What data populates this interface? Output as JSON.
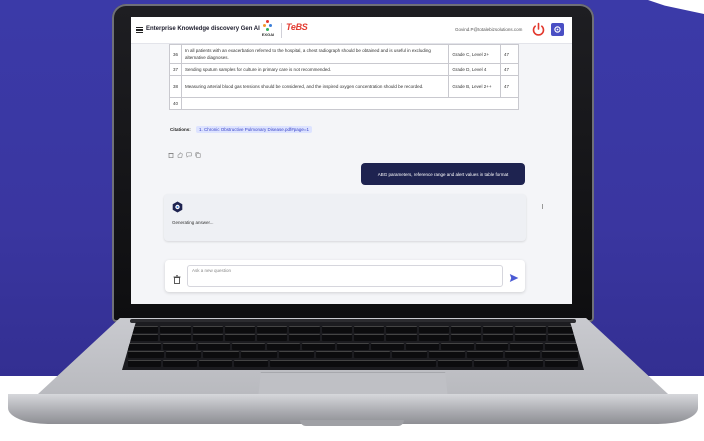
{
  "app": {
    "title": "Enterprise Knowledge discovery Gen AI",
    "exgai_logo_text": "EXGAI",
    "tebs_logo_text": "TeBS",
    "tebs_logo_tagline": "",
    "user_email": "Govind.P@totalebizsolutions.com",
    "accent_color": "#4a4fc4",
    "power_color": "#e2372c"
  },
  "table": {
    "rows": [
      {
        "num": "36",
        "recommendation": "In all patients with an exacerbation referred to the hospital, a chest radiograph should be obtained and is useful in excluding alternative diagnoses.",
        "grade": "Grade C, Level 2+",
        "ref": "47"
      },
      {
        "num": "37",
        "recommendation": "Sending sputum samples for culture in primary care is not recommended.",
        "grade": "Grade D, Level 4",
        "ref": "47"
      },
      {
        "num": "38",
        "recommendation": "Measuring arterial blood gas tensions should be considered, and the inspired oxygen concentration should be recorded.",
        "grade": "Grade B, Level 2++",
        "ref": "47"
      },
      {
        "num": "40",
        "recommendation": "",
        "grade": "",
        "ref": ""
      }
    ]
  },
  "citations": {
    "label": "Citations:",
    "link": "1. Chronic Obstructive Pulmonary Disease.pdf#page=1"
  },
  "chat": {
    "user_message": "ABG parameters, reference range and alert values in table format",
    "bot_status": "Generating answer..."
  },
  "input": {
    "placeholder": "Ask a new question"
  },
  "icons": {
    "menu": "hamburger-icon",
    "power": "power-icon",
    "settings": "gear-icon",
    "delete": "trash-icon",
    "like": "thumbs-up-icon",
    "comment": "comment-icon",
    "copy": "copy-icon",
    "avatar": "bot-avatar-icon",
    "send": "send-icon"
  }
}
